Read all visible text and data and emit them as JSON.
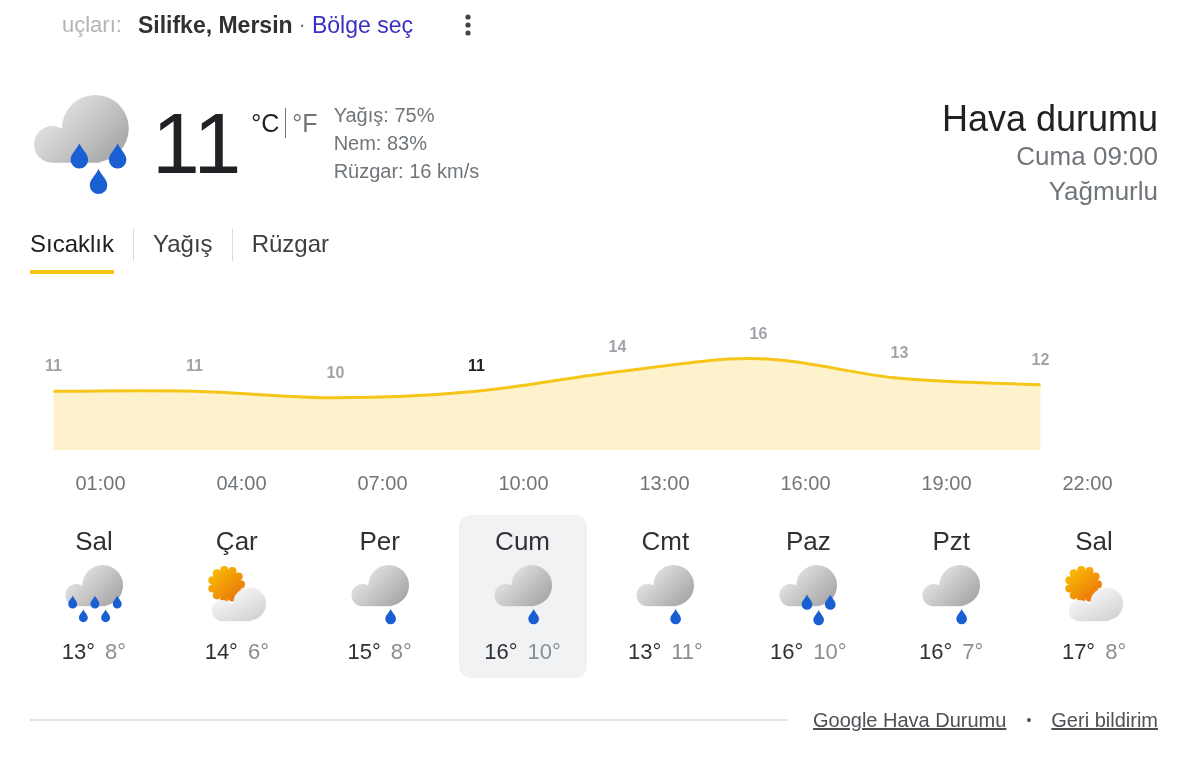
{
  "header": {
    "faded_text": "uçları:",
    "location": "Silifke, Mersin",
    "separator": "·",
    "region_link": "Bölge seç"
  },
  "current": {
    "kind": "rain",
    "temperature": "11",
    "units": [
      {
        "label": "°C",
        "selected": true
      },
      {
        "label": "°F",
        "selected": false
      }
    ],
    "details": [
      "Yağış: 75%",
      "Nem: 83%",
      "Rüzgar: 16 km/s"
    ]
  },
  "summary": {
    "title": "Hava durumu",
    "time": "Cuma 09:00",
    "condition": "Yağmurlu"
  },
  "tabs": [
    {
      "label": "Sıcaklık",
      "selected": true
    },
    {
      "label": "Yağış",
      "selected": false
    },
    {
      "label": "Rüzgar",
      "selected": false
    }
  ],
  "chart": {
    "chart_data": {
      "type": "area",
      "data_labels": true,
      "categories": [
        null,
        "01:00",
        null,
        null,
        "04:00",
        null,
        null,
        "07:00",
        null,
        null,
        "10:00",
        null,
        null,
        "13:00",
        null,
        null,
        "16:00",
        null,
        null,
        "19:00",
        null,
        null,
        "22:00",
        null
      ],
      "series": [
        {
          "color": "#f5c518",
          "values": [
            11,
            null,
            null,
            11,
            null,
            null,
            10,
            null,
            null,
            11,
            null,
            null,
            14,
            null,
            null,
            16,
            null,
            null,
            13,
            null,
            null,
            12,
            null,
            null
          ]
        }
      ]
    },
    "value_labels": [
      {
        "current": false
      },
      {
        "current": false
      },
      {
        "current": false
      },
      {
        "current": true
      },
      {
        "current": false
      },
      {
        "current": false
      },
      {
        "current": false
      },
      {
        "current": false
      }
    ]
  },
  "days": [
    {
      "name": "Sal",
      "kind": "heavy-rain",
      "high": "13°",
      "low": "8°",
      "selected": false
    },
    {
      "name": "Çar",
      "kind": "partly-cloudy",
      "high": "14°",
      "low": "6°",
      "selected": false
    },
    {
      "name": "Per",
      "kind": "light-rain",
      "high": "15°",
      "low": "8°",
      "selected": false
    },
    {
      "name": "Cum",
      "kind": "light-rain",
      "high": "16°",
      "low": "10°",
      "selected": true
    },
    {
      "name": "Cmt",
      "kind": "light-rain",
      "high": "13°",
      "low": "11°",
      "selected": false
    },
    {
      "name": "Paz",
      "kind": "rain",
      "high": "16°",
      "low": "10°",
      "selected": false
    },
    {
      "name": "Pzt",
      "kind": "light-rain",
      "high": "16°",
      "low": "7°",
      "selected": false
    },
    {
      "name": "Sal",
      "kind": "partly-cloudy",
      "high": "17°",
      "low": "8°",
      "selected": false
    }
  ],
  "footer": {
    "links": [
      "Google Hava Durumu",
      "Geri bildirim"
    ],
    "separator": "•"
  }
}
